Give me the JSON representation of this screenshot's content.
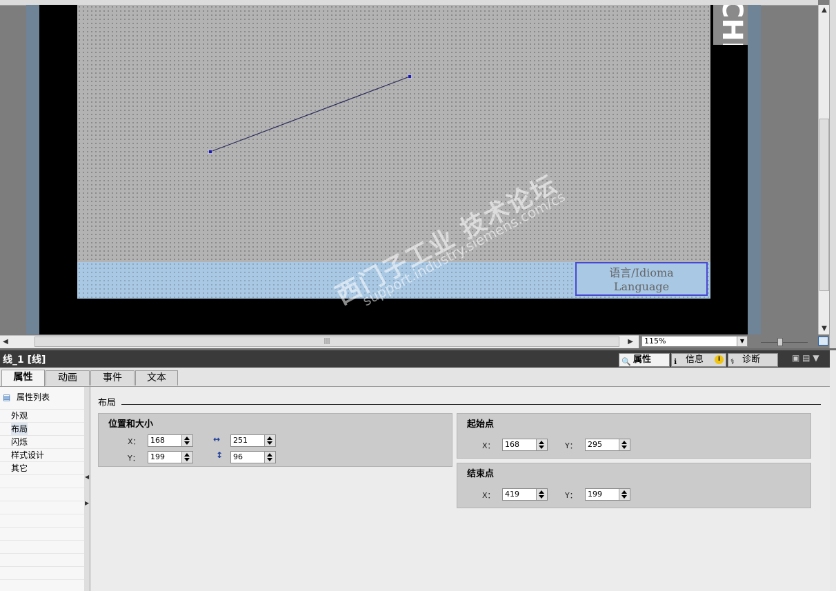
{
  "canvas": {
    "language_button": {
      "line1": "语言/Idioma",
      "line2": "Language"
    },
    "brand_text": "CHI",
    "line_object": {
      "start": [
        305,
        220
      ],
      "end": [
        594,
        111
      ]
    }
  },
  "zoom": {
    "value": "115%"
  },
  "hscroll": {
    "thumb_grip": "|||"
  },
  "inspector": {
    "title": "线_1 [线]",
    "header_tabs": [
      {
        "label": "属性",
        "icon": "properties-icon"
      },
      {
        "label": "信息",
        "icon": "info-icon"
      },
      {
        "label": "诊断",
        "icon": "diagnostics-icon"
      }
    ],
    "tabs": [
      "属性",
      "动画",
      "事件",
      "文本"
    ],
    "nav": {
      "header": "属性列表",
      "items": [
        "外观",
        "布局",
        "闪烁",
        "样式设计",
        "其它"
      ],
      "selected": "布局"
    },
    "section_title": "布局",
    "position_size": {
      "title": "位置和大小",
      "x_label": "X：",
      "x_value": "168",
      "y_label": "Y：",
      "y_value": "199",
      "width_value": "251",
      "height_value": "96"
    },
    "start_point": {
      "title": "起始点",
      "x_label": "X：",
      "x_value": "168",
      "y_label": "Y：",
      "y_value": "295"
    },
    "end_point": {
      "title": "结束点",
      "x_label": "X：",
      "x_value": "419",
      "y_label": "Y：",
      "y_value": "199"
    }
  },
  "watermark": {
    "line1": "西门子工业 技术论坛",
    "line2": "support.industry.siemens.com/cs"
  }
}
